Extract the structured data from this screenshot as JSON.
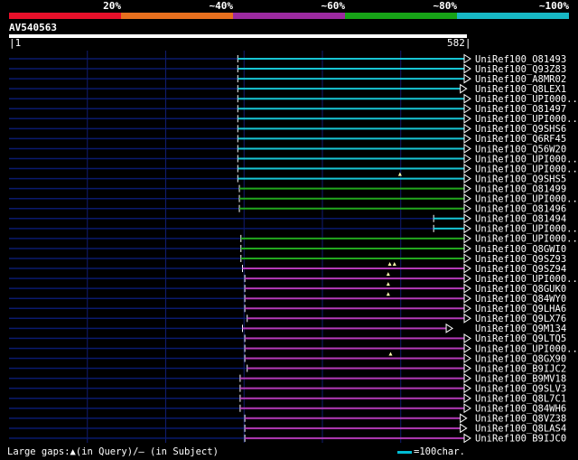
{
  "legend": {
    "labels": [
      "20%",
      "~40%",
      "~60%",
      "~80%",
      "~100%"
    ],
    "colors": [
      "#e8102a",
      "#e8701e",
      "#9c2aa0",
      "#17a317",
      "#17b8c4"
    ]
  },
  "query": {
    "name": "AV540563",
    "start": "1",
    "end": "582",
    "length": 582
  },
  "colors": {
    "cyan": "#17c5d4",
    "green": "#22a81e",
    "magenta": "#b43ab8",
    "navy": "#0a1a6e",
    "grid": "#101c70"
  },
  "hits": [
    {
      "label": "UniRef100_O81493",
      "start": 293,
      "end": 582,
      "color": "cyan",
      "arrow": true
    },
    {
      "label": "UniRef100_Q93Z83",
      "start": 293,
      "end": 582,
      "color": "cyan",
      "arrow": true
    },
    {
      "label": "UniRef100_A8MR02",
      "start": 293,
      "end": 582,
      "color": "cyan",
      "arrow": true
    },
    {
      "label": "UniRef100_Q8LEX1",
      "start": 293,
      "end": 577,
      "color": "cyan",
      "arrow": true
    },
    {
      "label": "UniRef100_UPI000..",
      "start": 293,
      "end": 582,
      "color": "cyan",
      "arrow": true
    },
    {
      "label": "UniRef100_O81497",
      "start": 293,
      "end": 582,
      "color": "cyan",
      "arrow": true
    },
    {
      "label": "UniRef100_UPI000..",
      "start": 293,
      "end": 582,
      "color": "cyan",
      "arrow": true
    },
    {
      "label": "UniRef100_Q9SHS6",
      "start": 293,
      "end": 582,
      "color": "cyan",
      "arrow": true
    },
    {
      "label": "UniRef100_Q6RF45",
      "start": 293,
      "end": 582,
      "color": "cyan",
      "arrow": true
    },
    {
      "label": "UniRef100_Q56W20",
      "start": 293,
      "end": 582,
      "color": "cyan",
      "arrow": true
    },
    {
      "label": "UniRef100_UPI000..",
      "start": 293,
      "end": 582,
      "color": "cyan",
      "arrow": true
    },
    {
      "label": "UniRef100_UPI000..",
      "start": 293,
      "end": 582,
      "color": "cyan",
      "arrow": true
    },
    {
      "label": "UniRef100_Q9SHS5",
      "start": 293,
      "end": 582,
      "color": "cyan",
      "arrow": true
    },
    {
      "label": "UniRef100_O81499",
      "start": 295,
      "end": 582,
      "color": "green",
      "arrow": true
    },
    {
      "label": "UniRef100_UPI000..",
      "start": 295,
      "end": 582,
      "color": "green",
      "arrow": true
    },
    {
      "label": "UniRef100_O81496",
      "start": 295,
      "end": 582,
      "color": "green",
      "arrow": true
    },
    {
      "label": "UniRef100_O81494",
      "start": 543,
      "end": 582,
      "color": "cyan",
      "arrow": true
    },
    {
      "label": "UniRef100_UPI000..",
      "start": 543,
      "end": 582,
      "color": "cyan",
      "arrow": true
    },
    {
      "label": "UniRef100_UPI000..",
      "start": 297,
      "end": 582,
      "color": "green",
      "arrow": true
    },
    {
      "label": "UniRef100_Q8GWI0",
      "start": 297,
      "end": 582,
      "color": "green",
      "arrow": true
    },
    {
      "label": "UniRef100_Q9SZ93",
      "start": 297,
      "end": 582,
      "color": "green",
      "arrow": true
    },
    {
      "label": "UniRef100_Q9SZ94",
      "start": 299,
      "end": 582,
      "color": "magenta",
      "arrow": true
    },
    {
      "label": "UniRef100_UPI000..",
      "start": 302,
      "end": 582,
      "color": "magenta",
      "arrow": true
    },
    {
      "label": "UniRef100_Q8GUK0",
      "start": 302,
      "end": 582,
      "color": "magenta",
      "arrow": true
    },
    {
      "label": "UniRef100_Q84WY0",
      "start": 302,
      "end": 582,
      "color": "magenta",
      "arrow": true
    },
    {
      "label": "UniRef100_Q9LHA6",
      "start": 302,
      "end": 582,
      "color": "magenta",
      "arrow": true
    },
    {
      "label": "UniRef100_Q9LX76",
      "start": 305,
      "end": 582,
      "color": "magenta",
      "arrow": true
    },
    {
      "label": "UniRef100_Q9M134",
      "start": 299,
      "end": 559,
      "color": "magenta",
      "arrow": true
    },
    {
      "label": "UniRef100_Q9LTQ5",
      "start": 302,
      "end": 582,
      "color": "magenta",
      "arrow": true
    },
    {
      "label": "UniRef100_UPI000..",
      "start": 302,
      "end": 582,
      "color": "magenta",
      "arrow": true
    },
    {
      "label": "UniRef100_Q8GX90",
      "start": 302,
      "end": 582,
      "color": "magenta",
      "arrow": true
    },
    {
      "label": "UniRef100_B9IJC2",
      "start": 305,
      "end": 582,
      "color": "magenta",
      "arrow": true
    },
    {
      "label": "UniRef100_B9MV18",
      "start": 296,
      "end": 582,
      "color": "magenta",
      "arrow": true
    },
    {
      "label": "UniRef100_Q9SLV3",
      "start": 296,
      "end": 582,
      "color": "magenta",
      "arrow": true
    },
    {
      "label": "UniRef100_Q8L7C1",
      "start": 296,
      "end": 582,
      "color": "magenta",
      "arrow": true
    },
    {
      "label": "UniRef100_Q84WH6",
      "start": 296,
      "end": 582,
      "color": "magenta",
      "arrow": true
    },
    {
      "label": "UniRef100_Q8VZ38",
      "start": 302,
      "end": 577,
      "color": "magenta",
      "arrow": true
    },
    {
      "label": "UniRef100_Q8LAS4",
      "start": 302,
      "end": 577,
      "color": "magenta",
      "arrow": true
    },
    {
      "label": "UniRef100_B9IJC0",
      "start": 302,
      "end": 582,
      "color": "magenta",
      "arrow": true
    }
  ],
  "query_gap_marks": [
    {
      "row": 12,
      "pos": 500
    },
    {
      "row": 21,
      "pos": 487
    },
    {
      "row": 21,
      "pos": 493
    },
    {
      "row": 22,
      "pos": 485
    },
    {
      "row": 23,
      "pos": 485
    },
    {
      "row": 24,
      "pos": 485
    },
    {
      "row": 30,
      "pos": 488
    }
  ],
  "footer": {
    "gaps_text": "Large gaps:▲(in Query)/– (in Subject)",
    "scale_text": "=100char."
  }
}
